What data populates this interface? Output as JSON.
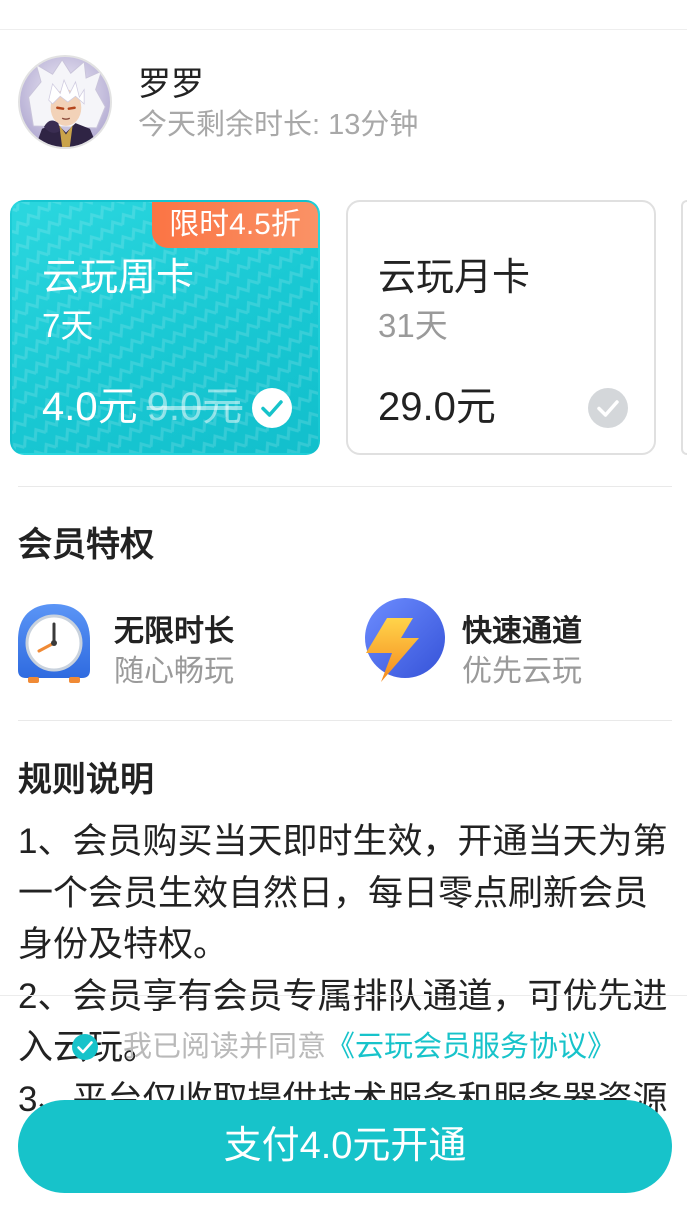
{
  "user": {
    "name": "罗罗",
    "remaining_time": "今天剩余时长: 13分钟"
  },
  "plans": [
    {
      "title": "云玩周卡",
      "duration": "7天",
      "price": "4.0元",
      "original_price": "9.0元",
      "badge": "限时4.5折",
      "selected": true,
      "check_icon": "check-circle-icon"
    },
    {
      "title": "云玩月卡",
      "duration": "31天",
      "price": "29.0元",
      "selected": false,
      "check_icon": "check-circle-icon"
    }
  ],
  "privileges": {
    "heading": "会员特权",
    "items": [
      {
        "title": "无限时长",
        "subtitle": "随心畅玩",
        "icon": "alarm-clock-icon"
      },
      {
        "title": "快速通道",
        "subtitle": "优先云玩",
        "icon": "lightning-bolt-icon"
      }
    ]
  },
  "rules": {
    "heading": "规则说明",
    "lines": [
      "1、会员购买当天即时生效，开通当天为第",
      "一个会员生效自然日，每日零点刷新会员",
      "身份及特权。",
      "2、会员享有会员专属排队通道，可优先进",
      "入云玩。",
      "3、平台仅收取提供技术服务和服务器资源"
    ]
  },
  "agreement": {
    "checked": true,
    "prefix": "我已阅读并同意",
    "link": "《云玩会员服务协议》",
    "check_icon": "check-circle-icon"
  },
  "pay_button": {
    "label": "支付4.0元开通"
  },
  "colors": {
    "accent": "#17c3ca",
    "badge": "#fb7444",
    "muted_text": "#a8a8a8"
  }
}
